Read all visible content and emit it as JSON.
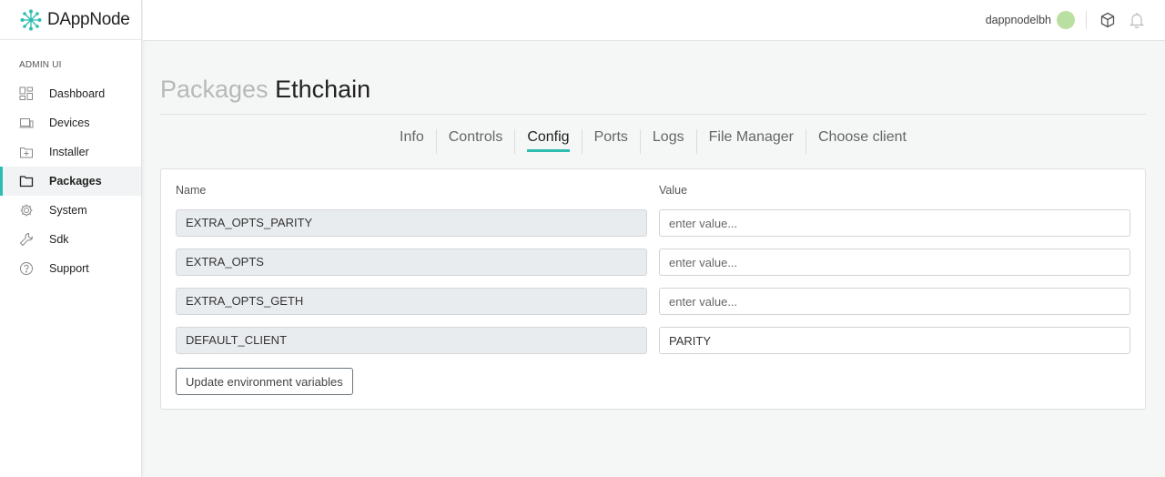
{
  "brand": {
    "name": "DAppNode",
    "accent": "#2fbcb0"
  },
  "sidebar": {
    "section_label": "ADMIN UI",
    "items": [
      {
        "label": "Dashboard",
        "icon": "dashboard-icon"
      },
      {
        "label": "Devices",
        "icon": "devices-icon"
      },
      {
        "label": "Installer",
        "icon": "installer-icon"
      },
      {
        "label": "Packages",
        "icon": "folder-icon",
        "active": true
      },
      {
        "label": "System",
        "icon": "gear-icon"
      },
      {
        "label": "Sdk",
        "icon": "wrench-icon"
      },
      {
        "label": "Support",
        "icon": "help-icon"
      }
    ]
  },
  "topbar": {
    "username": "dappnodelbh",
    "icons": [
      "avatar",
      "cube-icon",
      "bell-icon"
    ]
  },
  "page": {
    "title_prefix": "Packages",
    "title_name": "Ethchain"
  },
  "tabs": [
    {
      "label": "Info"
    },
    {
      "label": "Controls"
    },
    {
      "label": "Config",
      "active": true
    },
    {
      "label": "Ports"
    },
    {
      "label": "Logs"
    },
    {
      "label": "File Manager"
    },
    {
      "label": "Choose client"
    }
  ],
  "config": {
    "name_header": "Name",
    "value_header": "Value",
    "rows": [
      {
        "name": "EXTRA_OPTS_PARITY",
        "value": "",
        "placeholder": "enter value..."
      },
      {
        "name": "EXTRA_OPTS",
        "value": "",
        "placeholder": "enter value..."
      },
      {
        "name": "EXTRA_OPTS_GETH",
        "value": "",
        "placeholder": "enter value..."
      },
      {
        "name": "DEFAULT_CLIENT",
        "value": "PARITY",
        "placeholder": "enter value..."
      }
    ],
    "update_button": "Update environment variables"
  }
}
